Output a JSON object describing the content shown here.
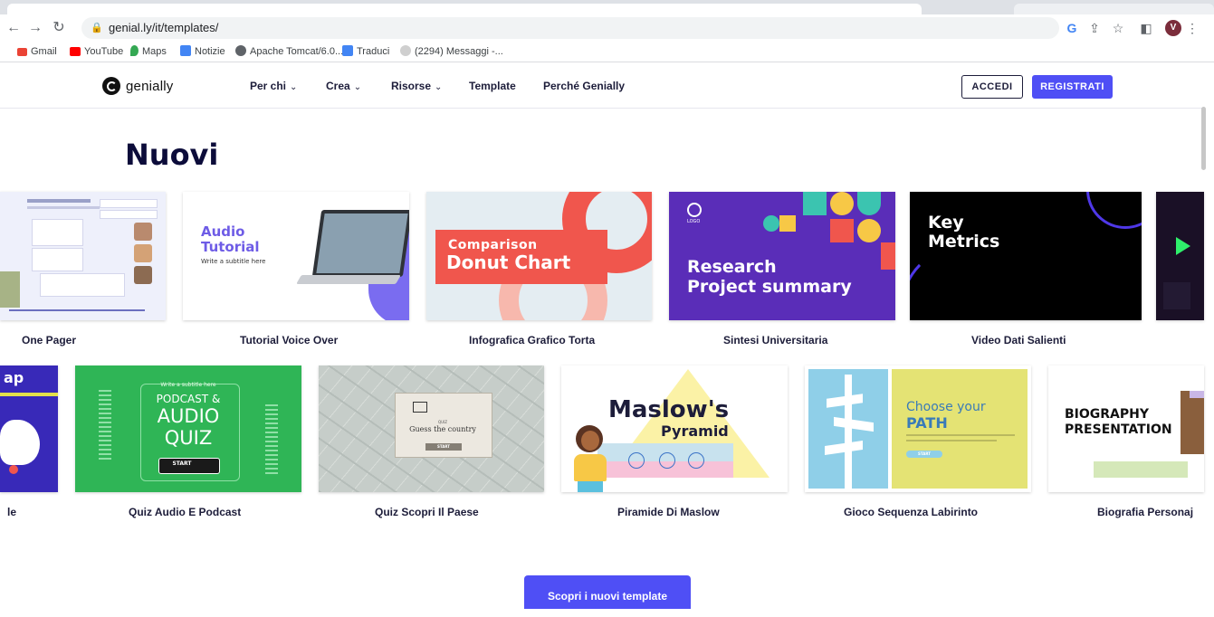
{
  "browser": {
    "url": "genial.ly/it/templates/",
    "bookmarks": [
      "Gmail",
      "YouTube",
      "Maps",
      "Notizie",
      "Apache Tomcat/6.0....",
      "Traduci",
      "(2294) Messaggi -..."
    ],
    "profile_initial": "V"
  },
  "header": {
    "logo_text": "genially",
    "menu": [
      "Per chi",
      "Crea",
      "Risorse",
      "Template",
      "Perché Genially"
    ],
    "login_label": "ACCEDI",
    "register_label": "REGISTRATI"
  },
  "section_title": "Nuovi",
  "row1": [
    "One Pager",
    "Tutorial Voice Over",
    "Infografica Grafico Torta",
    "Sintesi Universitaria",
    "Video Dati Salienti"
  ],
  "row2": [
    "le",
    "Quiz Audio E Podcast",
    "Quiz Scopri Il Paese",
    "Piramide Di Maslow",
    "Gioco Sequenza Labirinto",
    "Biografia Personaj"
  ],
  "thumbs": {
    "audio_tutorial": [
      "Audio",
      "Tutorial",
      "Write a subtitle here"
    ],
    "donut": [
      "Comparison",
      "Donut Chart"
    ],
    "research": [
      "Research",
      "Project summary",
      "LOGO"
    ],
    "metrics": [
      "Key",
      "Metrics"
    ],
    "map_fragment": "ap",
    "podcast": [
      "Write a subtitle here",
      "PODCAST &",
      "AUDIO",
      "QUIZ",
      "START"
    ],
    "country": [
      "QUIZ",
      "Guess the country",
      "START"
    ],
    "maslow": [
      "Maslow's",
      "Pyramid"
    ],
    "path": [
      "Choose your",
      "PATH",
      "START"
    ],
    "bio": [
      "BIOGRAPHY",
      "PRESENTATION"
    ]
  },
  "cta_label": "Scopri i nuovi template",
  "colors": {
    "brand": "#4f4ff5",
    "title": "#0c0c3a"
  }
}
